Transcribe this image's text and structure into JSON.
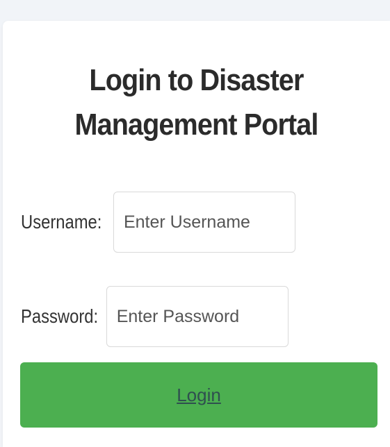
{
  "form": {
    "title": "Login to Disaster Management Portal",
    "username_label": "Username:",
    "username_placeholder": "Enter Username",
    "password_label": "Password:",
    "password_placeholder": "Enter Password",
    "login_label": "Login"
  },
  "colors": {
    "page_background": "#f1f4f8",
    "card_background": "#ffffff",
    "button_background": "#4caf50"
  }
}
